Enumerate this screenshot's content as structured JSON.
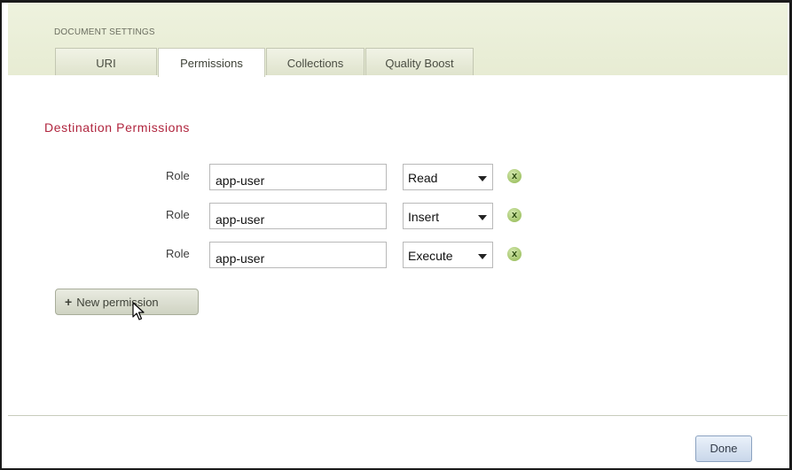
{
  "dialog": {
    "title": "DOCUMENT SETTINGS",
    "tabs": [
      {
        "label": "URI",
        "active": false
      },
      {
        "label": "Permissions",
        "active": true
      },
      {
        "label": "Collections",
        "active": false
      },
      {
        "label": "Quality Boost",
        "active": false
      }
    ]
  },
  "permissions": {
    "heading": "Destination Permissions",
    "rows": [
      {
        "role_label": "Role",
        "role_value": "app-user",
        "capability": "Read",
        "remove_icon": "x-icon"
      },
      {
        "role_label": "Role",
        "role_value": "app-user",
        "capability": "Insert",
        "remove_icon": "x-icon"
      },
      {
        "role_label": "Role",
        "role_value": "app-user",
        "capability": "Execute",
        "remove_icon": "x-icon"
      }
    ],
    "new_permission_label": "New permission",
    "new_permission_icon": "+"
  },
  "footer": {
    "done_label": "Done"
  },
  "colors": {
    "heading": "#b0253e",
    "header_bg": "#e7ecd3",
    "remove_icon": "#a3c56a"
  }
}
